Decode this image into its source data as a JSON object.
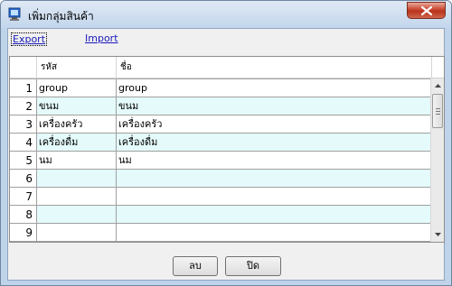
{
  "window": {
    "title": "เพิ่มกลุ่มสินค้า"
  },
  "toolbar": {
    "export_label": "Export",
    "import_label": "Import"
  },
  "table": {
    "columns": [
      "รหัส",
      "ชื่อ"
    ],
    "rows": [
      {
        "num": "1",
        "code": "group",
        "name": "group"
      },
      {
        "num": "2",
        "code": "ขนม",
        "name": "ขนม"
      },
      {
        "num": "3",
        "code": "เครื่องครัว",
        "name": "เครื่องครัว"
      },
      {
        "num": "4",
        "code": "เครื่องดื่ม",
        "name": "เครื่องดื่ม"
      },
      {
        "num": "5",
        "code": "นม",
        "name": "นม"
      },
      {
        "num": "6",
        "code": "",
        "name": ""
      },
      {
        "num": "7",
        "code": "",
        "name": ""
      },
      {
        "num": "8",
        "code": "",
        "name": ""
      },
      {
        "num": "9",
        "code": "",
        "name": ""
      }
    ]
  },
  "buttons": {
    "delete_label": "ลบ",
    "close_label": "ปิด"
  },
  "colors": {
    "alt_row": "#e4fafb",
    "close_button": "#c8452f",
    "link": "#1a1ab8"
  },
  "icons": {
    "title": "app-window-icon",
    "close": "close-icon"
  }
}
